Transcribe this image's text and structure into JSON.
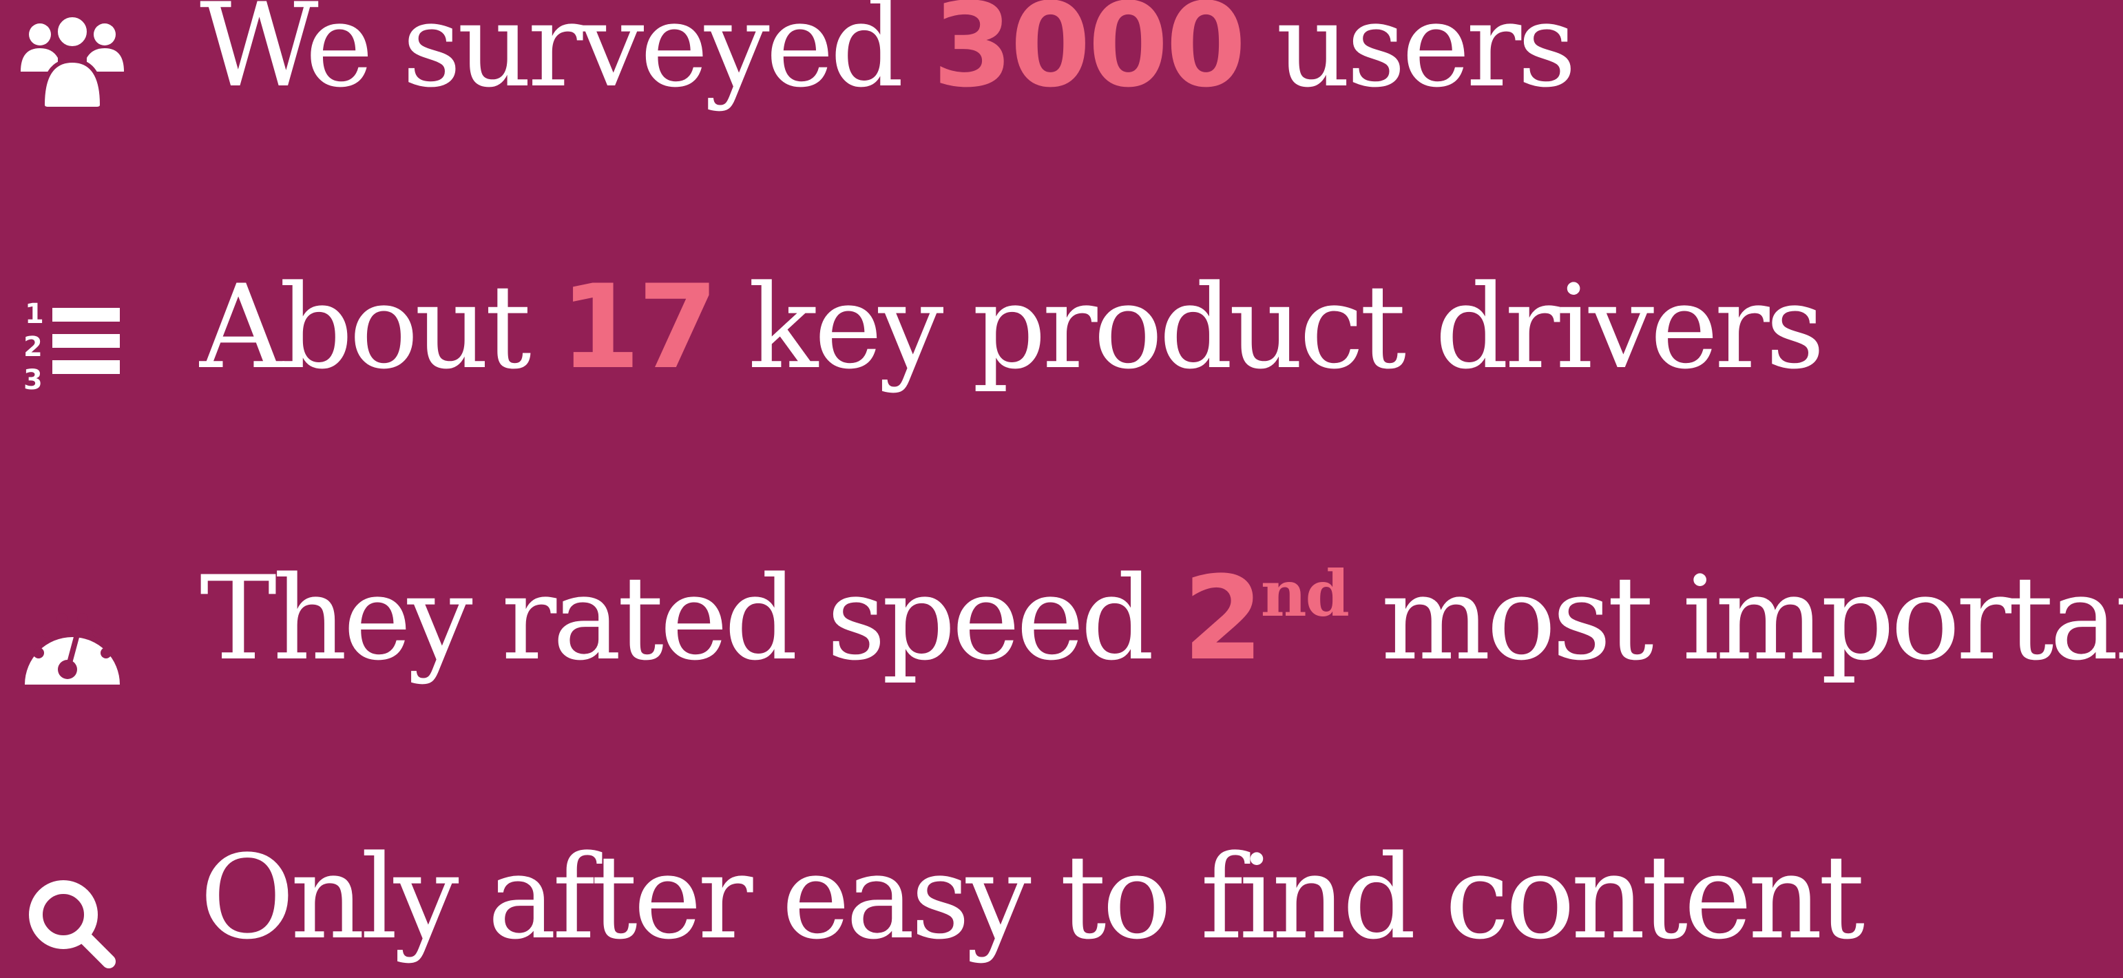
{
  "rows": [
    {
      "icon": "users-icon",
      "before": "We surveyed ",
      "highlight": "3000",
      "after": " users"
    },
    {
      "icon": "ordered-list-icon",
      "before": "About ",
      "highlight": "17",
      "after": " key product drivers"
    },
    {
      "icon": "speedometer-icon",
      "before": "They rated speed ",
      "highlight": "2",
      "superscript": "nd",
      "after": " most important"
    },
    {
      "icon": "search-icon",
      "text": "Only after easy to find content"
    }
  ],
  "colors": {
    "background": "#931f55",
    "text": "#ffffff",
    "highlight": "#f06a81"
  }
}
